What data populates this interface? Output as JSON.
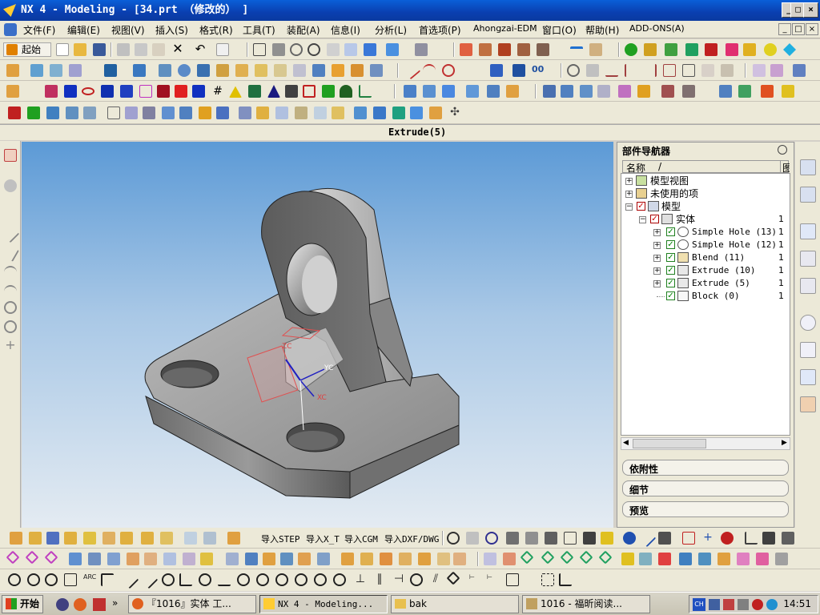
{
  "window": {
    "title": "NX 4 - Modeling - [34.prt （修改的） ]",
    "controls": [
      "_",
      "□",
      "×"
    ]
  },
  "menu": {
    "items": [
      "文件(F)",
      "编辑(E)",
      "视图(V)",
      "插入(S)",
      "格式(R)",
      "工具(T)",
      "装配(A)",
      "信息(I)",
      "分析(L)",
      "首选项(P)",
      "Ahongzai-EDM",
      "窗口(O)",
      "帮助(H)",
      "ADD-ONS(A)"
    ],
    "doc_controls": [
      "_",
      "□",
      "×"
    ]
  },
  "toolbar": {
    "start_label": "起始"
  },
  "cue_line": "Extrude(5)",
  "viewport": {
    "axis_labels": [
      "ZC",
      "YC",
      "XC"
    ]
  },
  "navigator": {
    "title": "部件导航器",
    "columns": {
      "name": "名称",
      "sort": "/",
      "extra": "图"
    },
    "tree": [
      {
        "label": "模型视图",
        "level": 0,
        "count": ""
      },
      {
        "label": "未使用的项",
        "level": 0,
        "count": ""
      },
      {
        "label": "模型",
        "level": 0,
        "count": ""
      },
      {
        "label": "实体",
        "level": 1,
        "count": "1"
      },
      {
        "label": "Simple Hole (13)",
        "level": 2,
        "count": "1"
      },
      {
        "label": "Simple Hole (12)",
        "level": 2,
        "count": "1"
      },
      {
        "label": "Blend (11)",
        "level": 2,
        "count": "1"
      },
      {
        "label": "Extrude (10)",
        "level": 2,
        "count": "1"
      },
      {
        "label": "Extrude (5)",
        "level": 2,
        "count": "1"
      },
      {
        "label": "Block (0)",
        "level": 2,
        "count": "1"
      }
    ],
    "panels": [
      "依附性",
      "细节",
      "预览"
    ]
  },
  "bottom_toolbar": {
    "import_buttons": [
      "导入STEP",
      "导入X_T",
      "导入CGM",
      "导入DXF/DWG"
    ]
  },
  "taskbar": {
    "start": "开始",
    "tasks": [
      "『1016』实体 工...",
      "NX 4 - Modeling...",
      "bak",
      "1016 - 福昕阅读..."
    ],
    "tray_tag": "CH",
    "clock": "14:51"
  },
  "colors": {
    "title_bar": "#0a4bc4",
    "viewport_top": "#5c9ad6",
    "viewport_bottom": "#e4ebf2",
    "part_gray": "#8a8a8a",
    "check_green": "#008000"
  }
}
